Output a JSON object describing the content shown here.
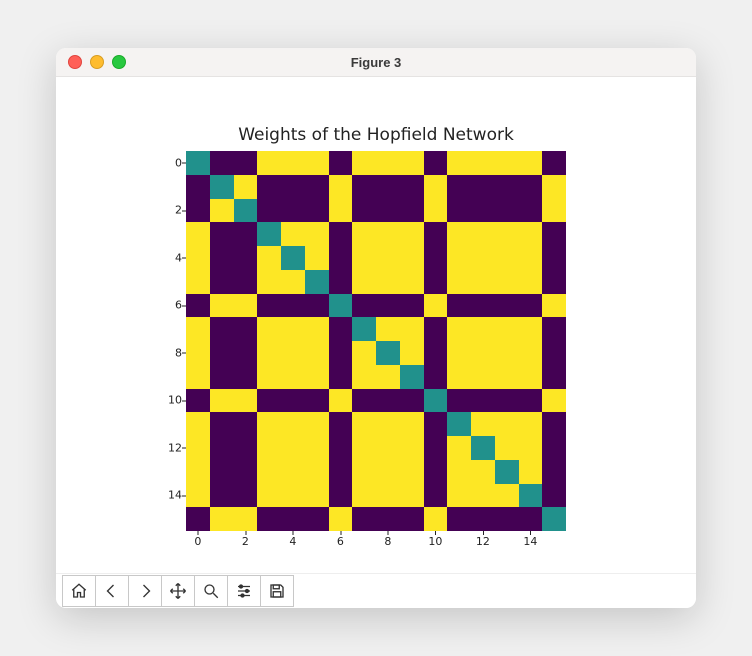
{
  "window": {
    "title": "Figure 3"
  },
  "toolbar": {
    "items": [
      {
        "name": "home-icon"
      },
      {
        "name": "back-icon"
      },
      {
        "name": "forward-icon"
      },
      {
        "name": "pan-icon"
      },
      {
        "name": "zoom-icon"
      },
      {
        "name": "configure-icon"
      },
      {
        "name": "save-icon"
      }
    ]
  },
  "chart_data": {
    "type": "heatmap",
    "title": "Weights of the Hopfield Network",
    "xlabel": "",
    "ylabel": "",
    "xtick_labels": [
      "0",
      "2",
      "4",
      "6",
      "8",
      "10",
      "12",
      "14"
    ],
    "ytick_labels": [
      "0",
      "2",
      "4",
      "6",
      "8",
      "10",
      "12",
      "14"
    ],
    "xticks": [
      0,
      2,
      4,
      6,
      8,
      10,
      12,
      14
    ],
    "yticks": [
      0,
      2,
      4,
      6,
      8,
      10,
      12,
      14
    ],
    "n": 16,
    "colormap": {
      "neg": "#440154",
      "zero": "#21918c",
      "pos": "#fde725"
    },
    "matrix": [
      [
        0,
        -1,
        -1,
        1,
        1,
        1,
        -1,
        1,
        1,
        1,
        -1,
        1,
        1,
        1,
        1,
        -1
      ],
      [
        -1,
        0,
        1,
        -1,
        -1,
        -1,
        1,
        -1,
        -1,
        -1,
        1,
        -1,
        -1,
        -1,
        -1,
        1
      ],
      [
        -1,
        1,
        0,
        -1,
        -1,
        -1,
        1,
        -1,
        -1,
        -1,
        1,
        -1,
        -1,
        -1,
        -1,
        1
      ],
      [
        1,
        -1,
        -1,
        0,
        1,
        1,
        -1,
        1,
        1,
        1,
        -1,
        1,
        1,
        1,
        1,
        -1
      ],
      [
        1,
        -1,
        -1,
        1,
        0,
        1,
        -1,
        1,
        1,
        1,
        -1,
        1,
        1,
        1,
        1,
        -1
      ],
      [
        1,
        -1,
        -1,
        1,
        1,
        0,
        -1,
        1,
        1,
        1,
        -1,
        1,
        1,
        1,
        1,
        -1
      ],
      [
        -1,
        1,
        1,
        -1,
        -1,
        -1,
        0,
        -1,
        -1,
        -1,
        1,
        -1,
        -1,
        -1,
        -1,
        1
      ],
      [
        1,
        -1,
        -1,
        1,
        1,
        1,
        -1,
        0,
        1,
        1,
        -1,
        1,
        1,
        1,
        1,
        -1
      ],
      [
        1,
        -1,
        -1,
        1,
        1,
        1,
        -1,
        1,
        0,
        1,
        -1,
        1,
        1,
        1,
        1,
        -1
      ],
      [
        1,
        -1,
        -1,
        1,
        1,
        1,
        -1,
        1,
        1,
        0,
        -1,
        1,
        1,
        1,
        1,
        -1
      ],
      [
        -1,
        1,
        1,
        -1,
        -1,
        -1,
        1,
        -1,
        -1,
        -1,
        0,
        -1,
        -1,
        -1,
        -1,
        1
      ],
      [
        1,
        -1,
        -1,
        1,
        1,
        1,
        -1,
        1,
        1,
        1,
        -1,
        0,
        1,
        1,
        1,
        -1
      ],
      [
        1,
        -1,
        -1,
        1,
        1,
        1,
        -1,
        1,
        1,
        1,
        -1,
        1,
        0,
        1,
        1,
        -1
      ],
      [
        1,
        -1,
        -1,
        1,
        1,
        1,
        -1,
        1,
        1,
        1,
        -1,
        1,
        1,
        0,
        1,
        -1
      ],
      [
        1,
        -1,
        -1,
        1,
        1,
        1,
        -1,
        1,
        1,
        1,
        -1,
        1,
        1,
        1,
        0,
        -1
      ],
      [
        -1,
        1,
        1,
        -1,
        -1,
        -1,
        1,
        -1,
        -1,
        -1,
        1,
        -1,
        -1,
        -1,
        -1,
        0
      ]
    ]
  }
}
